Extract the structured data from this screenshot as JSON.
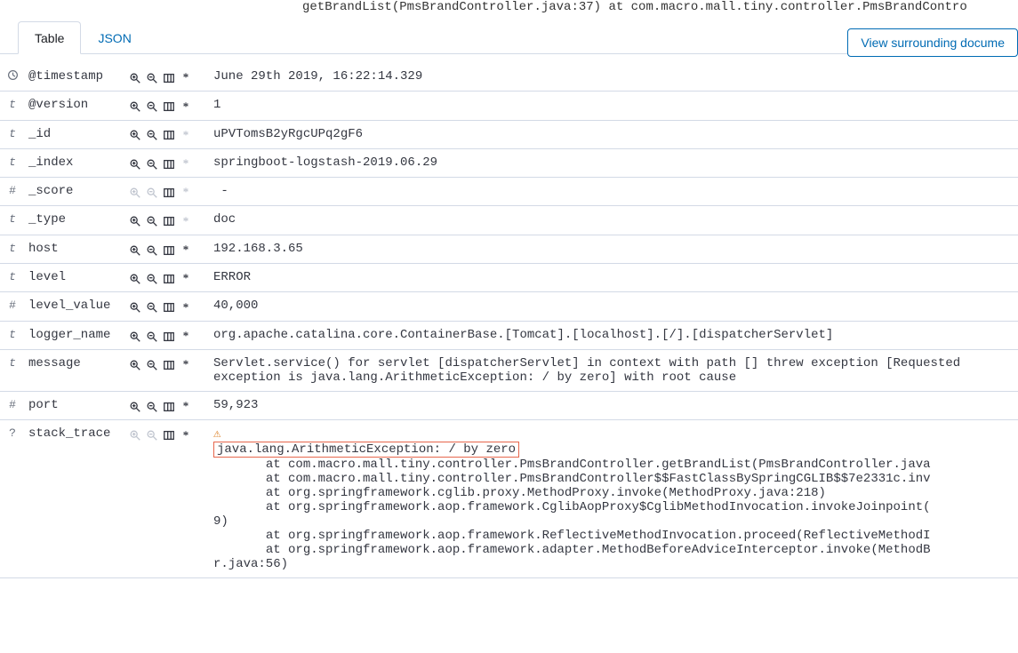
{
  "truncated_top": "getBrandList(PmsBrandController.java:37) at com.macro.mall.tiny.controller.PmsBrandContro",
  "tabs": {
    "table": "Table",
    "json": "JSON"
  },
  "view_docs_label": "View surrounding docume",
  "rows": [
    {
      "type": "clock",
      "name": "@timestamp",
      "value": "June 29th 2019, 16:22:14.329",
      "zoom_dim": false,
      "ast_dim": false
    },
    {
      "type": "t",
      "name": "@version",
      "value": "1",
      "zoom_dim": false,
      "ast_dim": false
    },
    {
      "type": "t",
      "name": "_id",
      "value": "uPVTomsB2yRgcUPq2gF6",
      "zoom_dim": false,
      "ast_dim": true
    },
    {
      "type": "t",
      "name": "_index",
      "value": "springboot-logstash-2019.06.29",
      "zoom_dim": false,
      "ast_dim": true
    },
    {
      "type": "#",
      "name": "_score",
      "value": " -",
      "zoom_dim": true,
      "ast_dim": true
    },
    {
      "type": "t",
      "name": "_type",
      "value": "doc",
      "zoom_dim": false,
      "ast_dim": true
    },
    {
      "type": "t",
      "name": "host",
      "value": "192.168.3.65",
      "zoom_dim": false,
      "ast_dim": false
    },
    {
      "type": "t",
      "name": "level",
      "value": "ERROR",
      "zoom_dim": false,
      "ast_dim": false
    },
    {
      "type": "#",
      "name": "level_value",
      "value": "40,000",
      "zoom_dim": false,
      "ast_dim": false
    },
    {
      "type": "t",
      "name": "logger_name",
      "value": "org.apache.catalina.core.ContainerBase.[Tomcat].[localhost].[/].[dispatcherServlet]",
      "zoom_dim": false,
      "ast_dim": false
    },
    {
      "type": "t",
      "name": "message",
      "value": "Servlet.service() for servlet [dispatcherServlet] in context with path [] threw exception [Requested exception is java.lang.ArithmeticException: / by zero] with root cause",
      "zoom_dim": false,
      "ast_dim": false
    },
    {
      "type": "#",
      "name": "port",
      "value": "59,923",
      "zoom_dim": false,
      "ast_dim": false
    }
  ],
  "stack_trace": {
    "type": "?",
    "name": "stack_trace",
    "highlighted": "java.lang.ArithmeticException: / by zero",
    "lines_after": "\n       at com.macro.mall.tiny.controller.PmsBrandController.getBrandList(PmsBrandController.java\n       at com.macro.mall.tiny.controller.PmsBrandController$$FastClassBySpringCGLIB$$7e2331c.inv\n       at org.springframework.cglib.proxy.MethodProxy.invoke(MethodProxy.java:218)\n       at org.springframework.aop.framework.CglibAopProxy$CglibMethodInvocation.invokeJoinpoint(\n9)\n       at org.springframework.aop.framework.ReflectiveMethodInvocation.proceed(ReflectiveMethodI\n       at org.springframework.aop.framework.adapter.MethodBeforeAdviceInterceptor.invoke(MethodB\nr.java:56)"
  }
}
